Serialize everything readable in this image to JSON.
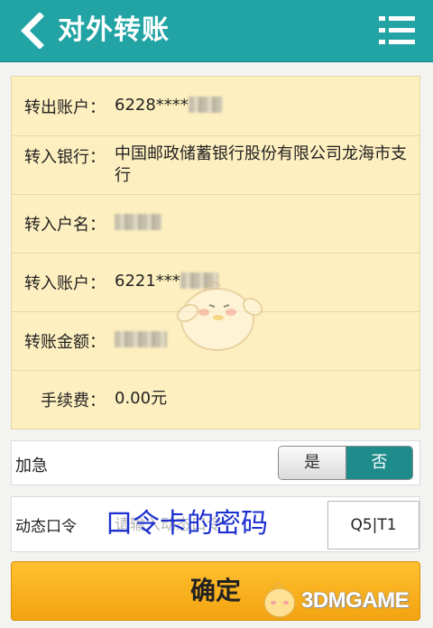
{
  "header": {
    "title": "对外转账",
    "back_icon": "chevron-left-icon",
    "menu_icon": "list-menu-icon",
    "color": "#22a3a4"
  },
  "details": [
    {
      "label": "转出账户：",
      "value": "6228****"
    },
    {
      "label": "转入银行：",
      "value": "中国邮政储蓄银行股份有限公司龙海市支行"
    },
    {
      "label": "转入户名：",
      "value": ""
    },
    {
      "label": "转入账户：",
      "value": "6221***"
    },
    {
      "label": "转账金额：",
      "value": ""
    },
    {
      "label": "手续费：",
      "value": "0.00元"
    }
  ],
  "urgent": {
    "label": "加急",
    "options": [
      "是",
      "否"
    ],
    "selected": "否"
  },
  "otp": {
    "label": "动态口令",
    "placeholder": "请输入动态口令",
    "overlay_text": "口令卡的密码",
    "code": "Q5|T1"
  },
  "confirm": {
    "label": "确定",
    "color": "#f7b21f"
  },
  "watermark": {
    "text": "3DMGAME"
  }
}
